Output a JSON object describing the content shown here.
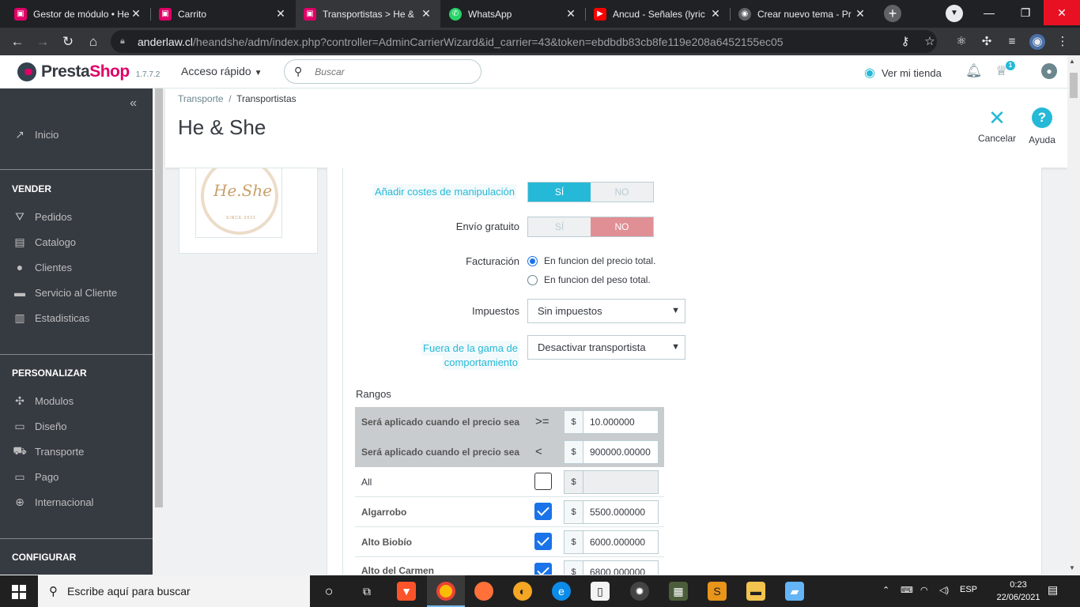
{
  "browser": {
    "tabs": [
      {
        "title": "Gestor de módulo • He",
        "favicon": "presta-icon",
        "color": "#df0067"
      },
      {
        "title": "Carrito",
        "favicon": "presta-icon",
        "color": "#df0067"
      },
      {
        "title": "Transportistas > He &",
        "favicon": "presta-icon",
        "color": "#df0067"
      },
      {
        "title": "WhatsApp",
        "favicon": "whatsapp-icon",
        "color": "#25d366"
      },
      {
        "title": "Ancud - Señales (lyric",
        "favicon": "youtube-icon",
        "color": "#ff0000"
      },
      {
        "title": "Crear nuevo tema - Pr",
        "favicon": "forum-icon",
        "color": "#5f6368"
      }
    ],
    "url_domain": "anderlaw.cl",
    "url_path": "/heandshe/adm/index.php?controller=AdminCarrierWizard&id_carrier=43&token=ebdbdb83cb8fe119e208a6452155ec05"
  },
  "header": {
    "brand_a": "Presta",
    "brand_b": "Shop",
    "version": "1.7.7.2",
    "quick_access": "Acceso rápido",
    "search_placeholder": "Buscar",
    "view_shop": "Ver mi tienda",
    "trophy_badge": "1"
  },
  "sidebar": {
    "home": "Inicio",
    "sections": [
      {
        "title": "VENDER",
        "items": [
          "Pedidos",
          "Catalogo",
          "Clientes",
          "Servicio al Cliente",
          "Estadisticas"
        ]
      },
      {
        "title": "PERSONALIZAR",
        "items": [
          "Modulos",
          "Diseño",
          "Transporte",
          "Pago",
          "Internacional"
        ]
      },
      {
        "title": "CONFIGURAR",
        "items": []
      }
    ]
  },
  "page": {
    "breadcrumb_parent": "Transporte",
    "breadcrumb_sep": "/",
    "breadcrumb_current": "Transportistas",
    "title": "He & She",
    "cancel_label": "Cancelar",
    "help_label": "Ayuda"
  },
  "logo": {
    "text": "He.She",
    "sub": "SINCE 2021"
  },
  "form": {
    "handling_label": "Añadir costes de manipulación",
    "handling_yes": "SÍ",
    "handling_no": "NO",
    "handling_value": "yes",
    "free_label": "Envío gratuito",
    "free_yes": "SÍ",
    "free_no": "NO",
    "free_value": "no",
    "billing_label": "Facturación",
    "billing_opt1": "En funcion del precio total.",
    "billing_opt2": "En funcion del peso total.",
    "billing_selected": 1,
    "tax_label": "Impuestos",
    "tax_value": "Sin impuestos",
    "outofrange_label_1": "Fuera de la gama de",
    "outofrange_label_2": "comportamiento",
    "outofrange_value": "Desactivar transportista",
    "ranges_title": "Rangos"
  },
  "ranges": {
    "header_rows": [
      {
        "label": "Será aplicado cuando el precio sea",
        "op": ">=",
        "currency": "$",
        "value": "10.000000"
      },
      {
        "label": "Será aplicado cuando el precio sea",
        "op": "<",
        "currency": "$",
        "value": "900000.00000"
      }
    ],
    "zones": [
      {
        "name": "All",
        "checked": false,
        "currency": "$",
        "price": ""
      },
      {
        "name": "Algarrobo",
        "checked": true,
        "currency": "$",
        "price": "5500.000000"
      },
      {
        "name": "Alto Biobío",
        "checked": true,
        "currency": "$",
        "price": "6000.000000"
      },
      {
        "name": "Alto del Carmen",
        "checked": true,
        "currency": "$",
        "price": "6800.000000"
      }
    ]
  },
  "taskbar": {
    "search_placeholder": "Escribe aquí para buscar",
    "lang": "ESP",
    "time": "0:23",
    "date": "22/06/2021"
  }
}
